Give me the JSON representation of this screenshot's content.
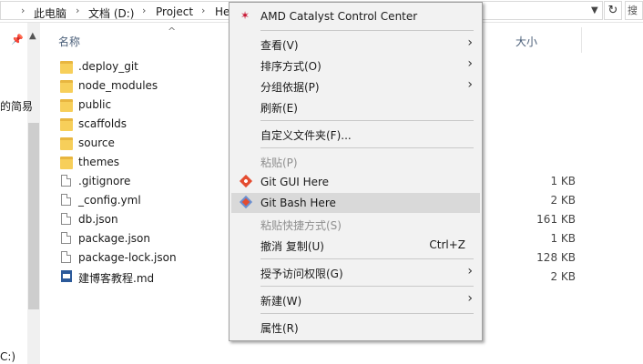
{
  "address": {
    "crumbs": [
      "此电脑",
      "文档 (D:)",
      "Project",
      "He"
    ],
    "separator": "›",
    "search_placeholder": "搜"
  },
  "nav": {
    "text1": "的简易",
    "text2": "C:)"
  },
  "columns": {
    "name": "名称",
    "size": "大小"
  },
  "files": [
    {
      "name": ".deploy_git",
      "type": "folder",
      "size": ""
    },
    {
      "name": "node_modules",
      "type": "folder",
      "size": ""
    },
    {
      "name": "public",
      "type": "folder",
      "size": ""
    },
    {
      "name": "scaffolds",
      "type": "folder",
      "size": ""
    },
    {
      "name": "source",
      "type": "folder",
      "size": ""
    },
    {
      "name": "themes",
      "type": "folder",
      "size": ""
    },
    {
      "name": ".gitignore",
      "type": "file",
      "size": "1 KB"
    },
    {
      "name": "_config.yml",
      "type": "file",
      "size": "2 KB"
    },
    {
      "name": "db.json",
      "type": "file",
      "size": "161 KB"
    },
    {
      "name": "package.json",
      "type": "file",
      "size": "1 KB"
    },
    {
      "name": "package-lock.json",
      "type": "file",
      "size": "128 KB"
    },
    {
      "name": "建博客教程.md",
      "type": "markdown",
      "size": "2 KB"
    }
  ],
  "menu": {
    "amd": "AMD Catalyst Control Center",
    "view": "查看(V)",
    "sort": "排序方式(O)",
    "group": "分组依据(P)",
    "refresh": "刷新(E)",
    "customize": "自定义文件夹(F)...",
    "paste": "粘贴(P)",
    "git_gui": "Git GUI Here",
    "git_bash": "Git Bash Here",
    "paste_shortcut": "粘贴快捷方式(S)",
    "undo_copy": "撤消 复制(U)",
    "undo_shortcut": "Ctrl+Z",
    "grant_access": "授予访问权限(G)",
    "new": "新建(W)",
    "properties": "属性(R)"
  },
  "colors": {
    "highlight": "#d9d9d9",
    "disabled_text": "#8f8f8f",
    "header_text": "#4c607a"
  }
}
